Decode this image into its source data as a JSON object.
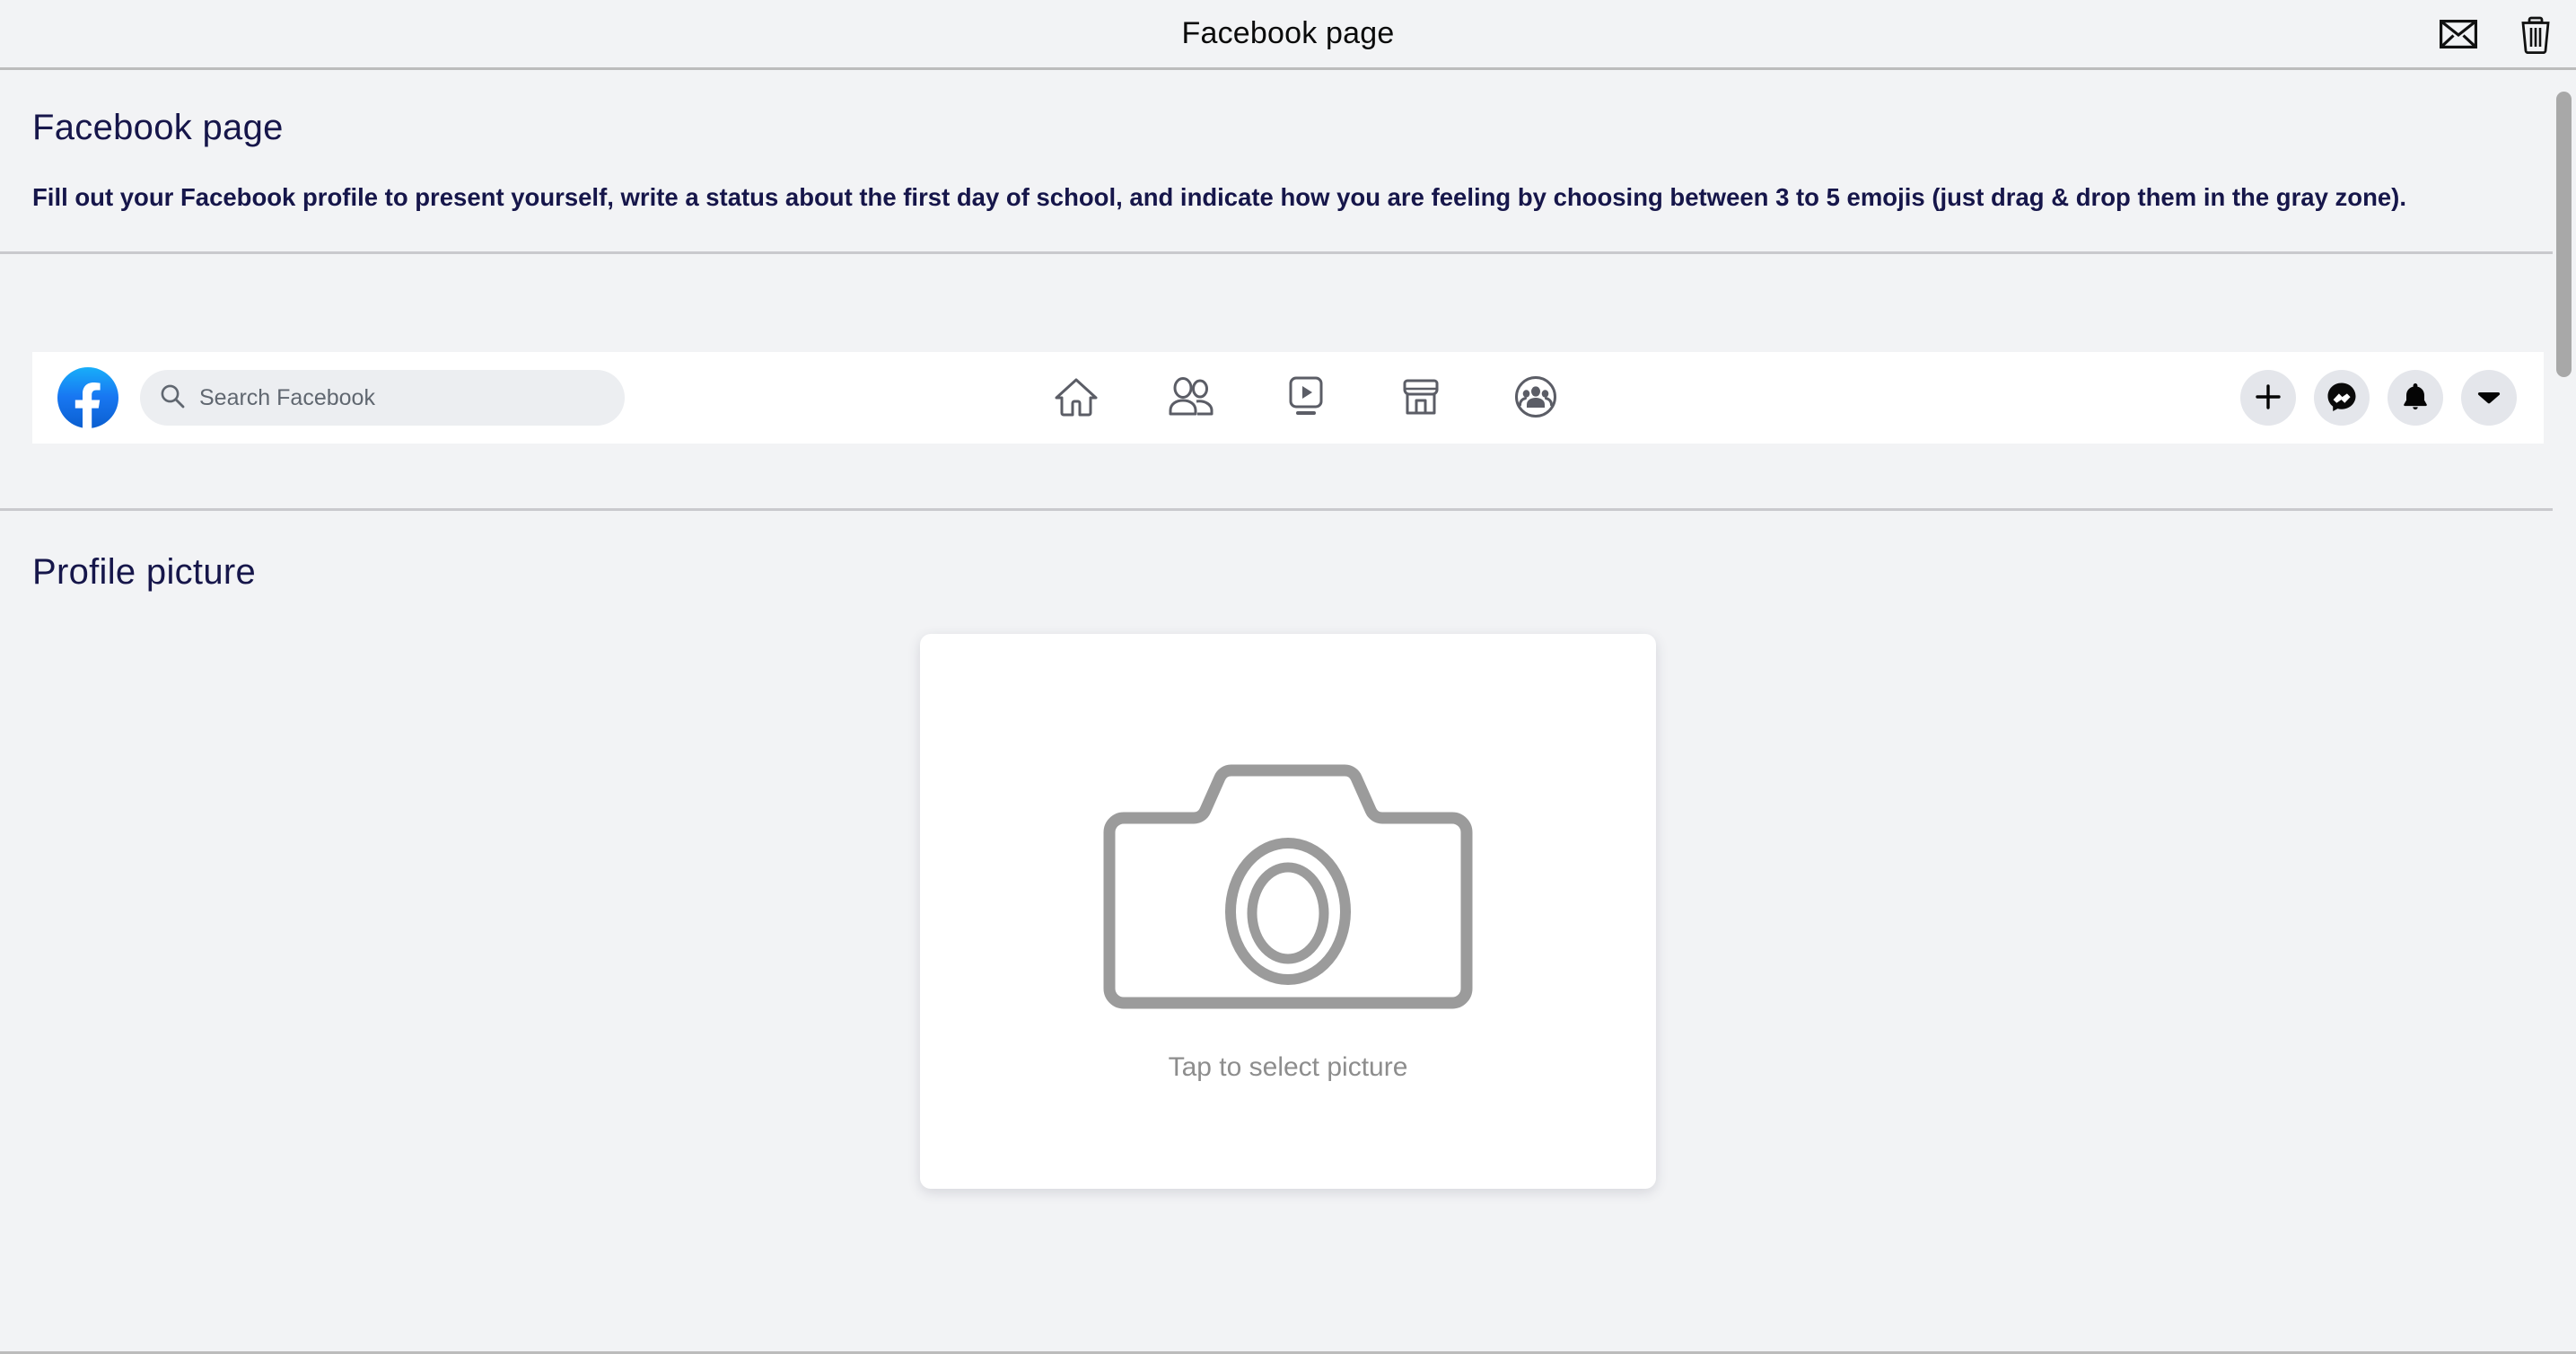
{
  "window": {
    "title": "Facebook page",
    "actions": [
      {
        "name": "mail-icon",
        "label": "Mail"
      },
      {
        "name": "trash-icon",
        "label": "Delete"
      }
    ]
  },
  "intro": {
    "title": "Facebook page",
    "description": "Fill out your Facebook profile to present yourself, write a status about the first day of school, and indicate how you are feeling by choosing between 3 to 5 emojis (just drag & drop them in the gray zone)."
  },
  "facebook_nav": {
    "logo_label": "Facebook",
    "search": {
      "placeholder": "Search Facebook",
      "value": ""
    },
    "tabs": [
      {
        "icon": "home-icon",
        "label": "Home"
      },
      {
        "icon": "friends-icon",
        "label": "Friends"
      },
      {
        "icon": "watch-video-icon",
        "label": "Watch"
      },
      {
        "icon": "marketplace-icon",
        "label": "Marketplace"
      },
      {
        "icon": "groups-icon",
        "label": "Groups"
      }
    ],
    "actions": [
      {
        "icon": "plus-icon",
        "label": "Create"
      },
      {
        "icon": "messenger-icon",
        "label": "Messenger"
      },
      {
        "icon": "bell-icon",
        "label": "Notifications"
      },
      {
        "icon": "chevron-down-icon",
        "label": "Account"
      }
    ]
  },
  "profile": {
    "section_title": "Profile picture",
    "picker": {
      "icon": "camera-icon",
      "caption": "Tap to select picture"
    }
  },
  "colors": {
    "page_background": "#f2f3f5",
    "heading_text": "#16164a",
    "facebook_blue": "#1877f2",
    "nav_icon": "#5b5d66",
    "placeholder_gray": "#8d8d8d",
    "divider": "#c9c9cd",
    "card_background": "#ffffff"
  },
  "scrollbar": {
    "orientation": "vertical",
    "thumb_position_pct": 2,
    "thumb_size_pct": 22
  }
}
